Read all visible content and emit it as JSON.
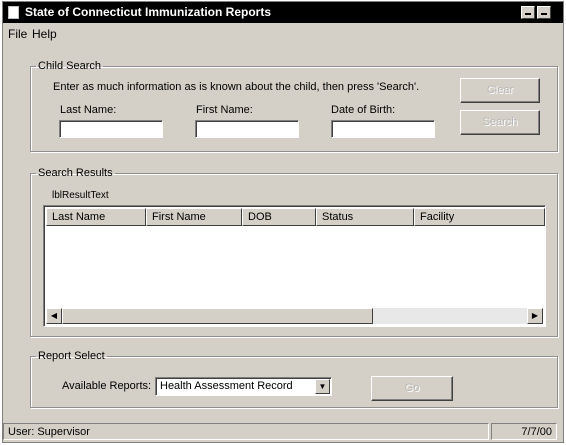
{
  "window": {
    "title": "State of Connecticut Immunization Reports"
  },
  "menu": {
    "file": "File",
    "help": "Help"
  },
  "child_search": {
    "legend": "Child Search",
    "instructions": "Enter as much information as is known about the child, then press 'Search'.",
    "last_name_label": "Last Name:",
    "first_name_label": "First Name:",
    "dob_label": "Date of Birth:",
    "last_name_value": "",
    "first_name_value": "",
    "dob_value": "",
    "clear_label": "Clear",
    "search_label": "Search"
  },
  "search_results": {
    "legend": "Search Results",
    "result_text": "lblResultText",
    "columns": [
      "Last Name",
      "First Name",
      "DOB",
      "Status",
      "Facility"
    ]
  },
  "report_select": {
    "legend": "Report Select",
    "available_label": "Available Reports:",
    "selected": "Health Assessment Record",
    "go_label": "Go"
  },
  "status": {
    "user": "User: Supervisor",
    "date": "7/7/00"
  }
}
